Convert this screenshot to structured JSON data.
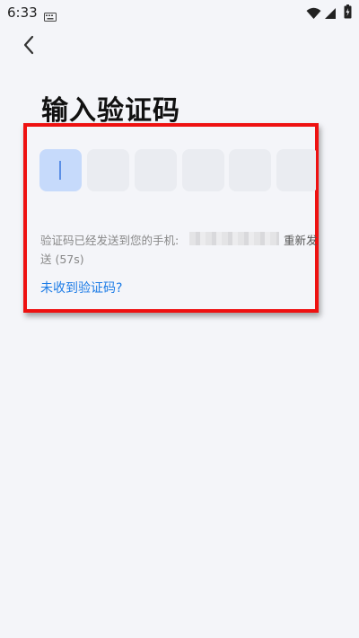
{
  "status_bar": {
    "time": "6:33",
    "icons": [
      "keyboard-icon",
      "wifi-icon",
      "signal-icon",
      "battery-icon"
    ]
  },
  "nav": {
    "back_icon": "chevron-left-icon"
  },
  "page": {
    "title": "输入验证码"
  },
  "code_input": {
    "cell_count": 6,
    "active_index": 0,
    "values": [
      "",
      "",
      "",
      "",
      "",
      ""
    ]
  },
  "info": {
    "sent_prefix": "验证码已经发送到您的手机:",
    "resend_label": "重新发",
    "countdown_line": "送 (57s)"
  },
  "help_link": "未收到验证码?",
  "colors": {
    "background": "#f4f5f9",
    "cell": "#eaecf1",
    "active_cell": "#c6dafb",
    "link": "#1d7ce6",
    "highlight": "#ee1111"
  }
}
